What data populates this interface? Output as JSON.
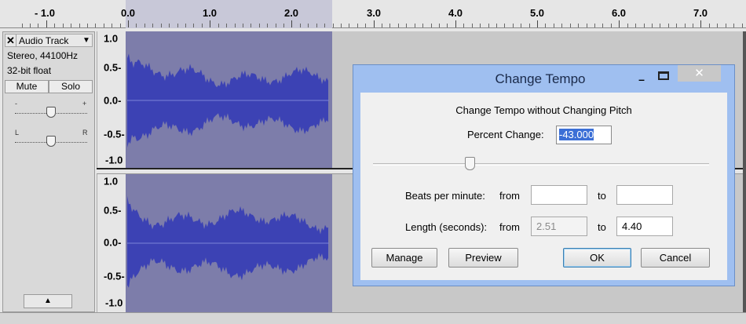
{
  "ruler": {
    "labels": [
      "- 1.0",
      "0.0",
      "1.0",
      "2.0",
      "3.0",
      "4.0",
      "5.0",
      "6.0",
      "7.0"
    ]
  },
  "track": {
    "close_glyph": "✕",
    "name": "Audio Track",
    "menu_glyph": "▼",
    "format": "Stereo, 44100Hz",
    "bit_depth": "32-bit float",
    "mute_label": "Mute",
    "solo_label": "Solo",
    "gain_minus": "-",
    "gain_plus": "+",
    "pan_left": "L",
    "pan_right": "R",
    "collapse_glyph": "▲"
  },
  "amplitude": {
    "channel1": [
      "1.0",
      "0.5-",
      "0.0-",
      "-0.5-",
      "-1.0"
    ],
    "channel2": [
      "1.0",
      "0.5-",
      "0.0-",
      "-0.5-",
      "-1.0"
    ]
  },
  "colors": {
    "waveform": "#3c42b4",
    "selection": "#7d7daa",
    "dialog_frame": "#9fbff0"
  },
  "dialog": {
    "title": "Change Tempo",
    "minimize_glyph": "–",
    "close_glyph": "✕",
    "heading": "Change Tempo without Changing Pitch",
    "percent_change_label": "Percent Change:",
    "percent_change_value": "-43.000",
    "percent_change": -43,
    "bpm_label": "Beats per minute:",
    "bpm_from_label": "from",
    "bpm_from_value": "",
    "bpm_to_label": "to",
    "bpm_to_value": "",
    "length_label": "Length (seconds):",
    "length_from_label": "from",
    "length_from_value": "2.51",
    "length_to_label": "to",
    "length_to_value": "4.40",
    "manage_label": "Manage",
    "preview_label": "Preview",
    "ok_label": "OK",
    "cancel_label": "Cancel"
  }
}
